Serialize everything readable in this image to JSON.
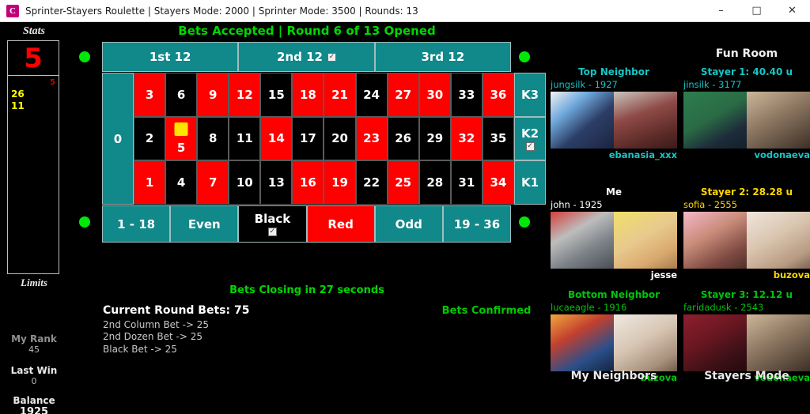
{
  "window": {
    "title": "Sprinter-Stayers Roulette | Stayers Mode: 2000 | Sprinter Mode: 3500 | Rounds: 13",
    "icon_letter": "C",
    "minimize": "–",
    "maximize": "□",
    "close": "✕"
  },
  "stats": {
    "title": "Stats",
    "last_number": "5",
    "history_red": "5",
    "history_yellow": [
      "26",
      "11"
    ],
    "limits_title": "Limits",
    "my_rank_label": "My Rank",
    "my_rank_value": "45",
    "last_win_label": "Last Win",
    "last_win_value": "0",
    "balance_label": "Balance",
    "balance_value": "1925"
  },
  "board": {
    "status": "Bets Accepted | Round 6 of 13 Opened",
    "closing": "Bets Closing in 27 seconds",
    "zero": "0",
    "dozens": [
      {
        "label": "1st 12",
        "checked": false
      },
      {
        "label": "2nd 12",
        "checked": true
      },
      {
        "label": "3rd 12",
        "checked": false
      }
    ],
    "rows": [
      [
        {
          "n": "3",
          "color": "red",
          "marked": false
        },
        {
          "n": "6",
          "color": "black",
          "marked": false
        },
        {
          "n": "9",
          "color": "red",
          "marked": false
        },
        {
          "n": "12",
          "color": "red",
          "marked": false
        },
        {
          "n": "15",
          "color": "black",
          "marked": false
        },
        {
          "n": "18",
          "color": "red",
          "marked": false
        },
        {
          "n": "21",
          "color": "red",
          "marked": false
        },
        {
          "n": "24",
          "color": "black",
          "marked": false
        },
        {
          "n": "27",
          "color": "red",
          "marked": false
        },
        {
          "n": "30",
          "color": "red",
          "marked": false
        },
        {
          "n": "33",
          "color": "black",
          "marked": false
        },
        {
          "n": "36",
          "color": "red",
          "marked": false
        }
      ],
      [
        {
          "n": "2",
          "color": "black",
          "marked": false
        },
        {
          "n": "5",
          "color": "red",
          "marked": true
        },
        {
          "n": "8",
          "color": "black",
          "marked": false
        },
        {
          "n": "11",
          "color": "black",
          "marked": false
        },
        {
          "n": "14",
          "color": "red",
          "marked": false
        },
        {
          "n": "17",
          "color": "black",
          "marked": false
        },
        {
          "n": "20",
          "color": "black",
          "marked": false
        },
        {
          "n": "23",
          "color": "red",
          "marked": false
        },
        {
          "n": "26",
          "color": "black",
          "marked": false
        },
        {
          "n": "29",
          "color": "black",
          "marked": false
        },
        {
          "n": "32",
          "color": "red",
          "marked": false
        },
        {
          "n": "35",
          "color": "black",
          "marked": false
        }
      ],
      [
        {
          "n": "1",
          "color": "red",
          "marked": false
        },
        {
          "n": "4",
          "color": "black",
          "marked": false
        },
        {
          "n": "7",
          "color": "red",
          "marked": false
        },
        {
          "n": "10",
          "color": "black",
          "marked": false
        },
        {
          "n": "13",
          "color": "black",
          "marked": false
        },
        {
          "n": "16",
          "color": "red",
          "marked": false
        },
        {
          "n": "19",
          "color": "red",
          "marked": false
        },
        {
          "n": "22",
          "color": "black",
          "marked": false
        },
        {
          "n": "25",
          "color": "red",
          "marked": false
        },
        {
          "n": "28",
          "color": "black",
          "marked": false
        },
        {
          "n": "31",
          "color": "black",
          "marked": false
        },
        {
          "n": "34",
          "color": "red",
          "marked": false
        }
      ]
    ],
    "columns": [
      {
        "label": "K3",
        "checked": false
      },
      {
        "label": "K2",
        "checked": true
      },
      {
        "label": "K1",
        "checked": false
      }
    ],
    "outside": [
      {
        "label": "1 - 18",
        "color": "teal",
        "checked": false
      },
      {
        "label": "Even",
        "color": "teal",
        "checked": false
      },
      {
        "label": "Black",
        "color": "black",
        "checked": true
      },
      {
        "label": "Red",
        "color": "red",
        "checked": false
      },
      {
        "label": "Odd",
        "color": "teal",
        "checked": false
      },
      {
        "label": "19 - 36",
        "color": "teal",
        "checked": false
      }
    ]
  },
  "bets": {
    "header": "Current Round Bets: 75",
    "lines": [
      "2nd Column Bet -> 25",
      "2nd Dozen Bet -> 25",
      "Black Bet -> 25"
    ],
    "confirmed": "Bets Confirmed"
  },
  "right": {
    "fun_room_title": "Fun Room",
    "my_neighbors_label": "My Neighbors",
    "stayers_mode_label": "Stayers Mode",
    "groups": [
      {
        "heading": "Top Neighbor",
        "heading_color": "cyan",
        "subtitle": "jungsilk -  1927",
        "footer": "ebanasia_xxx",
        "footer_color": "cyan"
      },
      {
        "heading": "Stayer 1: 40.40 u",
        "heading_color": "cyan",
        "subtitle": "jinsilk -  3177",
        "footer": "vodonaeva",
        "footer_color": "cyan"
      },
      {
        "heading": "Me",
        "heading_color": "white",
        "subtitle": "john - 1925",
        "footer": "jesse",
        "footer_color": "white"
      },
      {
        "heading": "Stayer 2: 28.28 u",
        "heading_color": "yellow",
        "subtitle": "sofia -  2555",
        "footer": "buzova",
        "footer_color": "yellow"
      },
      {
        "heading": "Bottom Neighbor",
        "heading_color": "green",
        "subtitle": "lucaeagle - 1916",
        "footer": "buzova",
        "footer_color": "green"
      },
      {
        "heading": "Stayer 3: 12.12 u",
        "heading_color": "green",
        "subtitle": "faridadusk -  2543",
        "footer": "vodonaeva",
        "footer_color": "green"
      }
    ]
  },
  "colors": {
    "teal": "#11888a",
    "red": "#fe0000",
    "green_status": "#00d700",
    "marker_yellow": "#ffe400",
    "dot_green": "#00e808"
  }
}
